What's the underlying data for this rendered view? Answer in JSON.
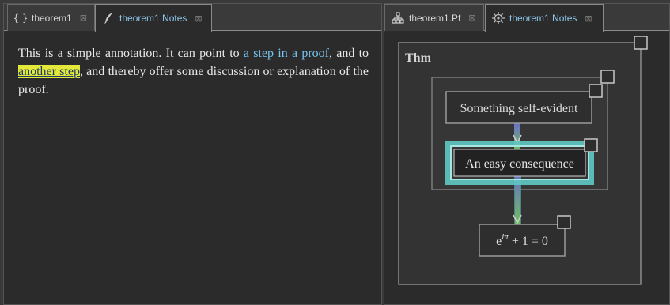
{
  "left_tabs": [
    {
      "icon": "braces-icon",
      "label": "theorem1",
      "active": false
    },
    {
      "icon": "quill-icon",
      "label": "theorem1.Notes",
      "active": true
    }
  ],
  "right_tabs": [
    {
      "icon": "tree-icon",
      "label": "theorem1.Pf",
      "active": false
    },
    {
      "icon": "gear-icon",
      "label": "theorem1.Notes",
      "active": true
    }
  ],
  "tab_close_glyph": "⊠",
  "note": {
    "part1": "This is a simple annotation. It can point to ",
    "link1": "a step in a proof",
    "part2": ", and to ",
    "link2": "another step",
    "part3": ", and thereby offer some discussion or explanation of the proof."
  },
  "graph": {
    "outer_label": "Thm",
    "node1": "Something self-evident",
    "node2": "An easy consequence",
    "node3": "e^{iπ} + 1 = 0",
    "node3_base": "e",
    "node3_sup": "iπ",
    "node3_rest": " + 1 = 0"
  },
  "colors": {
    "link": "#78c4f0",
    "highlight": "#e4e83a",
    "active_tab_text": "#8ec7ee",
    "node_glow": "#5fc8c4",
    "edge_top": "#6a6ed0",
    "edge_bottom": "#6fbf5a"
  }
}
